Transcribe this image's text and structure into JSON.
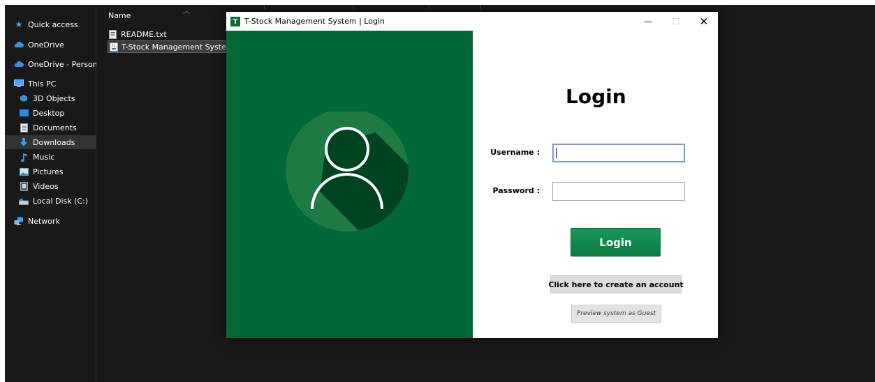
{
  "explorer": {
    "nav": {
      "quick_access": "Quick access",
      "onedrive": "OneDrive",
      "onedrive_personal": "OneDrive - Persona",
      "this_pc": "This PC",
      "objects_3d": "3D Objects",
      "desktop": "Desktop",
      "documents": "Documents",
      "downloads": "Downloads",
      "music": "Music",
      "pictures": "Pictures",
      "videos": "Videos",
      "local_disk": "Local Disk (C:)",
      "network": "Network"
    },
    "column_name": "Name",
    "files": [
      {
        "name": "README.txt"
      },
      {
        "name": "T-Stock Management System"
      }
    ]
  },
  "window": {
    "icon_letter": "T",
    "title": "T-Stock Management System | Login",
    "minimize": "—",
    "maximize": "☐",
    "close": "✕"
  },
  "login": {
    "heading": "Login",
    "username_label": "Username :",
    "username_value": "",
    "password_label": "Password :",
    "password_value": "",
    "login_button": "Login",
    "create_account": "Click here to create an account",
    "guest": "Preview system as Guest"
  },
  "colors": {
    "brand_green": "#016836",
    "button_green": "#0f8a4a",
    "explorer_bg": "#191919"
  }
}
